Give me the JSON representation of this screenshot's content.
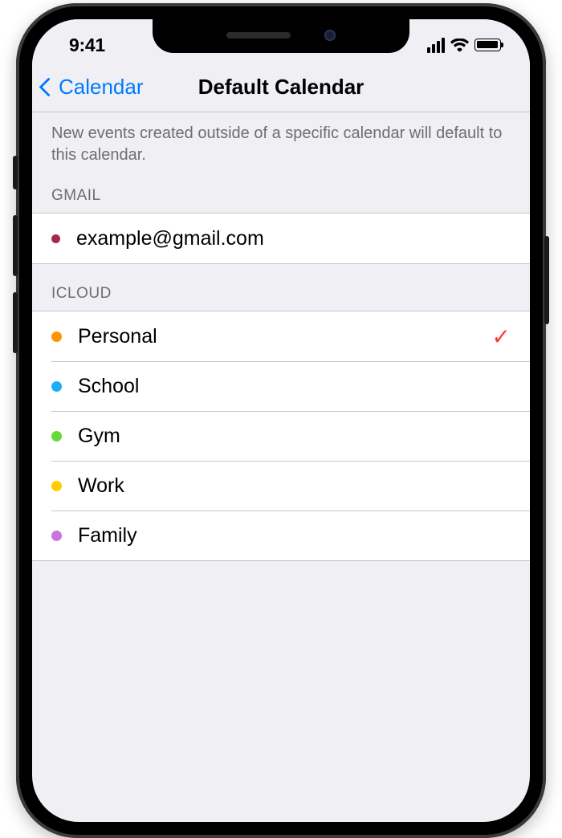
{
  "status": {
    "time": "9:41"
  },
  "nav": {
    "back": "Calendar",
    "title": "Default Calendar"
  },
  "description": "New events created outside of a specific calendar will default to this calendar.",
  "groups": [
    {
      "header": "GMAIL",
      "items": [
        {
          "label": "example@gmail.com",
          "color": "#a52a4a",
          "selected": false
        }
      ]
    },
    {
      "header": "ICLOUD",
      "items": [
        {
          "label": "Personal",
          "color": "#ff9500",
          "selected": true
        },
        {
          "label": "School",
          "color": "#1badf8",
          "selected": false
        },
        {
          "label": "Gym",
          "color": "#63da38",
          "selected": false
        },
        {
          "label": "Work",
          "color": "#ffcc00",
          "selected": false
        },
        {
          "label": "Family",
          "color": "#cc73e1",
          "selected": false
        }
      ]
    }
  ]
}
